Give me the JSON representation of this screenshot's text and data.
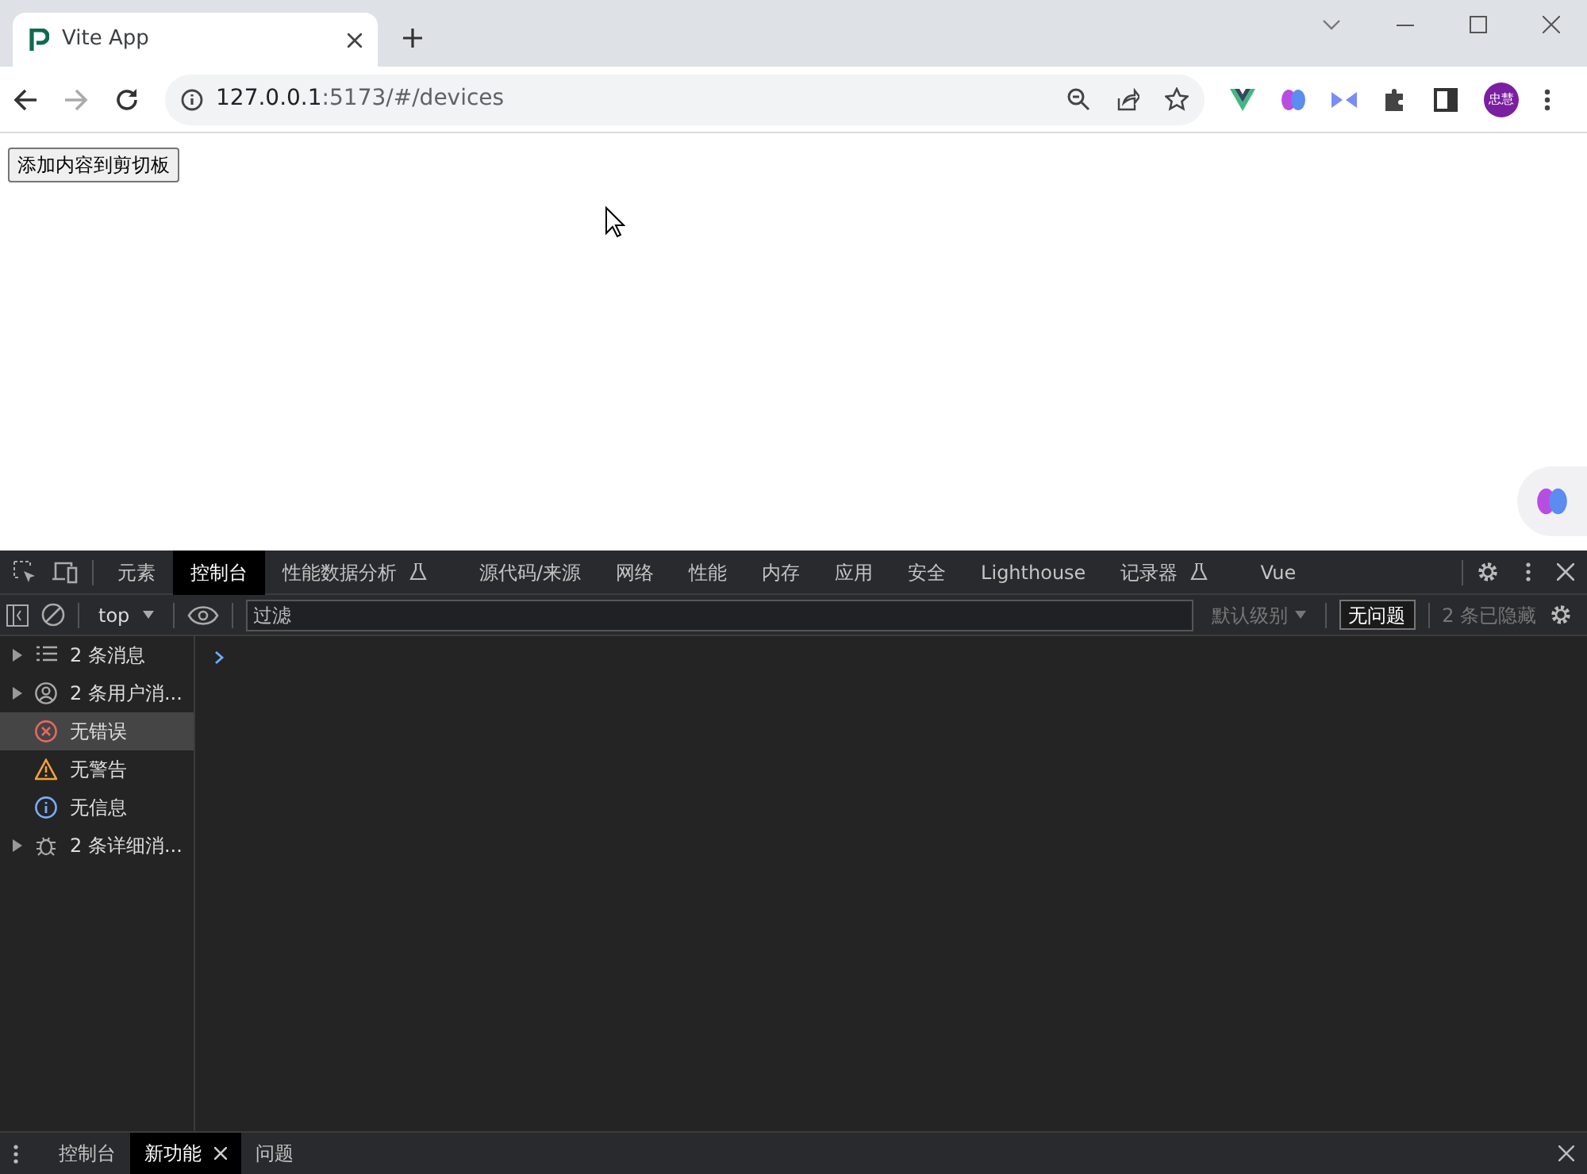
{
  "browser": {
    "tabs": [
      {
        "title": "Vite App",
        "selected": true
      }
    ],
    "address": {
      "host": "127.0.0.1",
      "rest": ":5173/#/devices"
    },
    "avatar": "忠慧"
  },
  "page": {
    "button": "添加内容到剪切板"
  },
  "devtools": {
    "tabs": [
      {
        "label": "元素",
        "selected": false,
        "experimental": false
      },
      {
        "label": "控制台",
        "selected": true,
        "experimental": false
      },
      {
        "label": "性能数据分析",
        "selected": false,
        "experimental": true
      },
      {
        "label": "源代码/来源",
        "selected": false,
        "experimental": false
      },
      {
        "label": "网络",
        "selected": false,
        "experimental": false
      },
      {
        "label": "性能",
        "selected": false,
        "experimental": false
      },
      {
        "label": "内存",
        "selected": false,
        "experimental": false
      },
      {
        "label": "应用",
        "selected": false,
        "experimental": false
      },
      {
        "label": "安全",
        "selected": false,
        "experimental": false
      },
      {
        "label": "Lighthouse",
        "selected": false,
        "experimental": false
      },
      {
        "label": "记录器",
        "selected": false,
        "experimental": true
      },
      {
        "label": "Vue",
        "selected": false,
        "experimental": false
      }
    ],
    "toolbar": {
      "context": "top",
      "filter_placeholder": "过滤",
      "level": "默认级别",
      "issues": "无问题",
      "hidden": "2 条已隐藏"
    },
    "sidebar": [
      {
        "label": "2 条消息",
        "kind": "messages",
        "expandable": true,
        "selected": false
      },
      {
        "label": "2 条用户消...",
        "kind": "user",
        "expandable": true,
        "selected": false
      },
      {
        "label": "无错误",
        "kind": "error",
        "expandable": false,
        "selected": true
      },
      {
        "label": "无警告",
        "kind": "warning",
        "expandable": false,
        "selected": false
      },
      {
        "label": "无信息",
        "kind": "info",
        "expandable": false,
        "selected": false
      },
      {
        "label": "2 条详细消...",
        "kind": "verbose",
        "expandable": true,
        "selected": false
      }
    ],
    "drawer_tabs": [
      {
        "label": "控制台",
        "selected": false,
        "closable": false
      },
      {
        "label": "新功能",
        "selected": true,
        "closable": true
      },
      {
        "label": "问题",
        "selected": false,
        "closable": false
      }
    ]
  }
}
